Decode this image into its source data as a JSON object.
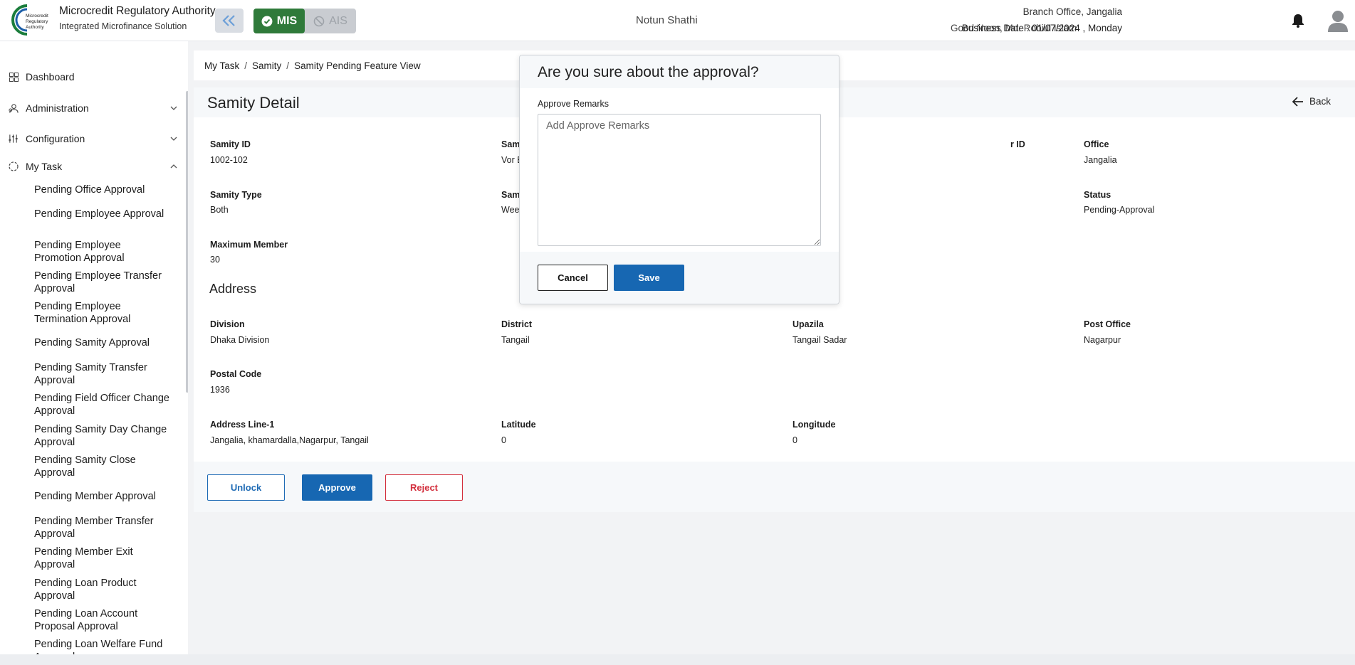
{
  "header": {
    "logo_text": "Microcredit Regulatory Authority",
    "brand_title": "Microcredit Regulatory Authority",
    "brand_subtitle": "Integrated Microfinance Solution",
    "module_mis": "MIS",
    "module_ais": "AIS",
    "app_name": "Notun Shathi",
    "greeting": "Good Noon, Md. Robiul Islam",
    "branch": "Branch Office, Jangalia",
    "business_date": "Business Date : 01/07/2024 , Monday",
    "colors": {
      "mis_active": "#2f7a3a",
      "primary": "#1767b2",
      "danger": "#d32f3d"
    }
  },
  "sidebar": {
    "items": [
      {
        "label": "Dashboard",
        "icon": "grid-icon"
      },
      {
        "label": "Administration",
        "icon": "admin-icon"
      },
      {
        "label": "Configuration",
        "icon": "sliders-icon"
      },
      {
        "label": "My Task",
        "icon": "task-icon"
      }
    ],
    "subitems": [
      "Pending Office Approval",
      "Pending Employee Approval",
      "Pending Employee Promotion Approval",
      "Pending Employee Transfer Approval",
      "Pending Employee Termination Approval",
      "Pending Samity Approval",
      "Pending Samity Transfer Approval",
      "Pending Field Officer Change Approval",
      "Pending Samity Day Change Approval",
      "Pending Samity Close Approval",
      "Pending Member Approval",
      "Pending Member Transfer Approval",
      "Pending Member Exit Approval",
      "Pending Loan Product Approval",
      "Pending Loan Account Proposal Approval",
      "Pending Loan Welfare Fund Approval"
    ]
  },
  "breadcrumb": [
    "My Task",
    "Samity",
    "Samity Pending Feature View"
  ],
  "detail": {
    "title": "Samity Detail",
    "back_label": "Back",
    "fields": {
      "samity_id": {
        "label": "Samity ID",
        "value": "1002-102"
      },
      "samity_name": {
        "label": "Sam",
        "value": "Vor E"
      },
      "field_officer": {
        "label": "r ID",
        "value": ""
      },
      "office": {
        "label": "Office",
        "value": "Jangalia"
      },
      "samity_type": {
        "label": "Samity Type",
        "value": "Both"
      },
      "samity_day": {
        "label": "Sam",
        "value": "Weel"
      },
      "status": {
        "label": "Status",
        "value": "Pending-Approval"
      },
      "max_member": {
        "label": "Maximum Member",
        "value": "30"
      }
    },
    "address": {
      "title": "Address",
      "division": {
        "label": "Division",
        "value": "Dhaka Division"
      },
      "district": {
        "label": "District",
        "value": "Tangail"
      },
      "upazila": {
        "label": "Upazila",
        "value": "Tangail Sadar"
      },
      "post_office": {
        "label": "Post Office",
        "value": "Nagarpur"
      },
      "postal_code": {
        "label": "Postal Code",
        "value": "1936"
      },
      "address_line1": {
        "label": "Address Line-1",
        "value": "Jangalia, khamardalla,Nagarpur, Tangail"
      },
      "latitude": {
        "label": "Latitude",
        "value": "0"
      },
      "longitude": {
        "label": "Longitude",
        "value": "0"
      }
    },
    "actions": {
      "unlock": "Unlock",
      "approve": "Approve",
      "reject": "Reject"
    }
  },
  "modal": {
    "title": "Are you sure about the approval?",
    "remarks_label": "Approve Remarks",
    "remarks_placeholder": "Add Approve Remarks",
    "remarks_value": "",
    "cancel": "Cancel",
    "save": "Save"
  }
}
